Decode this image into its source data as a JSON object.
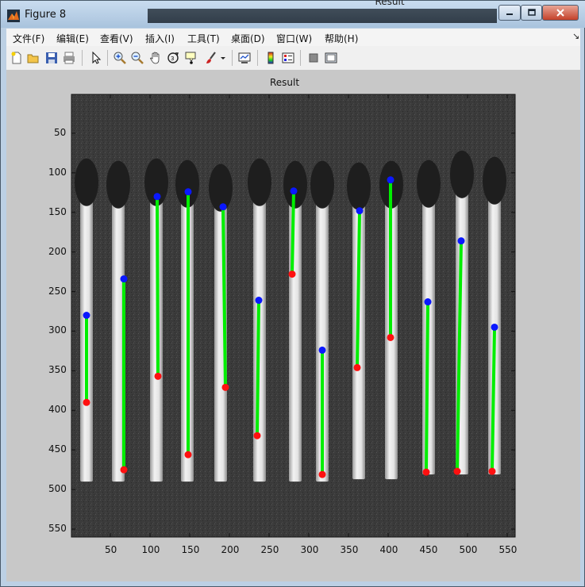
{
  "window": {
    "title": "Figure 8",
    "background_window_title": "Result",
    "minimize_icon": "minimize-icon",
    "maximize_icon": "maximize-icon",
    "close_icon": "close-icon"
  },
  "menubar": {
    "items": [
      "文件(F)",
      "编辑(E)",
      "查看(V)",
      "插入(I)",
      "工具(T)",
      "桌面(D)",
      "窗口(W)",
      "帮助(H)"
    ],
    "overflow_icon": "dock-arrow-icon"
  },
  "toolbar": {
    "icons": [
      "new-figure-icon",
      "open-file-icon",
      "save-icon",
      "print-icon",
      "pointer-icon",
      "zoom-in-icon",
      "zoom-out-icon",
      "pan-hand-icon",
      "rotate-3d-icon",
      "data-cursor-icon",
      "brush-icon",
      "brush-dropdown-icon",
      "link-plot-icon",
      "colorbar-icon",
      "legend-icon",
      "hide-plot-tools-icon",
      "show-plot-tools-icon"
    ]
  },
  "axes": {
    "title": "Result",
    "xlim": [
      1,
      560
    ],
    "ylim": [
      1,
      560
    ],
    "x_ticks": [
      "50",
      "100",
      "150",
      "200",
      "250",
      "300",
      "350",
      "400",
      "450",
      "500",
      "550"
    ],
    "y_ticks": [
      "50",
      "100",
      "150",
      "200",
      "250",
      "300",
      "350",
      "400",
      "450",
      "500",
      "550"
    ],
    "y_reversed": true
  },
  "chart_data": {
    "type": "scatter",
    "title": "Result",
    "xlabel": "",
    "ylabel": "",
    "xlim": [
      1,
      560
    ],
    "ylim": [
      560,
      1
    ],
    "colors": {
      "line": "#00ee00",
      "top_point": "#0a18ff",
      "bottom_point": "#ff1010"
    },
    "series": [
      {
        "type": "segments",
        "values": [
          {
            "x1": 20,
            "y1": 280,
            "x2": 20,
            "y2": 390
          },
          {
            "x1": 67,
            "y1": 234,
            "x2": 67,
            "y2": 475
          },
          {
            "x1": 109,
            "y1": 130,
            "x2": 110,
            "y2": 357
          },
          {
            "x1": 148,
            "y1": 124,
            "x2": 148,
            "y2": 456
          },
          {
            "x1": 192,
            "y1": 143,
            "x2": 195,
            "y2": 371
          },
          {
            "x1": 237,
            "y1": 261,
            "x2": 235,
            "y2": 432
          },
          {
            "x1": 281,
            "y1": 123,
            "x2": 279,
            "y2": 228
          },
          {
            "x1": 317,
            "y1": 324,
            "x2": 317,
            "y2": 481
          },
          {
            "x1": 364,
            "y1": 148,
            "x2": 361,
            "y2": 346
          },
          {
            "x1": 403,
            "y1": 109,
            "x2": 403,
            "y2": 308
          },
          {
            "x1": 450,
            "y1": 263,
            "x2": 448,
            "y2": 478
          },
          {
            "x1": 492,
            "y1": 186,
            "x2": 487,
            "y2": 477
          },
          {
            "x1": 534,
            "y1": 295,
            "x2": 531,
            "y2": 477
          }
        ]
      }
    ]
  },
  "scene": {
    "background": "#3b3b3b",
    "match_head_color": "#1e1e1e",
    "match_stick_color": "#e8e8e8",
    "matches": [
      {
        "x": 20,
        "head_y": 90,
        "end_y": 490
      },
      {
        "x": 60,
        "head_y": 93,
        "end_y": 490
      },
      {
        "x": 108,
        "head_y": 90,
        "end_y": 490
      },
      {
        "x": 147,
        "head_y": 92,
        "end_y": 490
      },
      {
        "x": 189,
        "head_y": 97,
        "end_y": 490
      },
      {
        "x": 238,
        "head_y": 90,
        "end_y": 490
      },
      {
        "x": 283,
        "head_y": 93,
        "end_y": 490
      },
      {
        "x": 317,
        "head_y": 93,
        "end_y": 490
      },
      {
        "x": 363,
        "head_y": 95,
        "end_y": 487
      },
      {
        "x": 404,
        "head_y": 93,
        "end_y": 487
      },
      {
        "x": 451,
        "head_y": 92,
        "end_y": 481
      },
      {
        "x": 493,
        "head_y": 80,
        "end_y": 481
      },
      {
        "x": 534,
        "head_y": 88,
        "end_y": 481
      }
    ]
  }
}
